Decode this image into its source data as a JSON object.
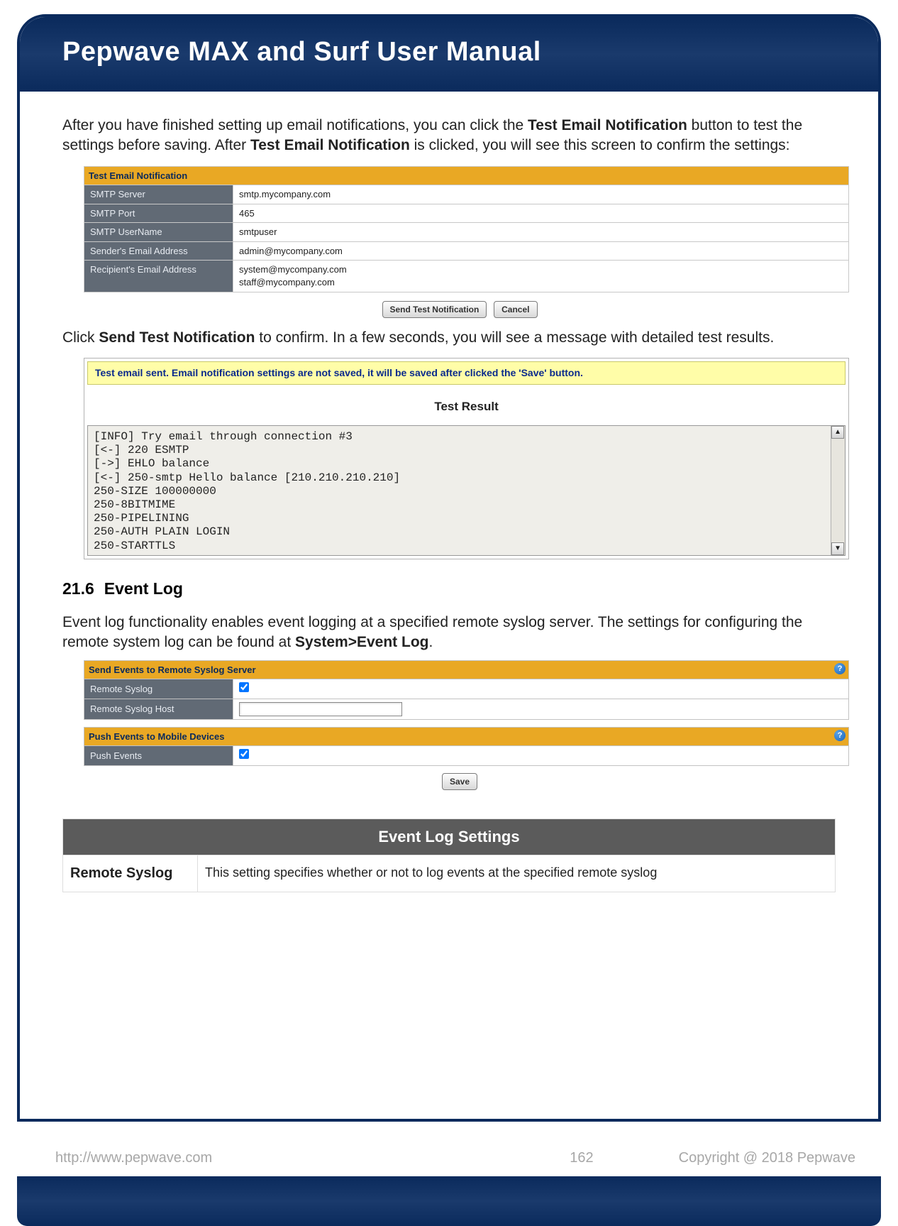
{
  "title": "Pepwave MAX and Surf User Manual",
  "intro": {
    "pre": "After you have finished setting up email notifications, you can click the ",
    "b1": "Test Email Notification",
    "mid1": " button to test the settings before saving. After ",
    "b2": "Test Email Notification",
    "post": " is clicked, you will see this screen to confirm the settings:"
  },
  "table1": {
    "header": "Test Email Notification",
    "rows": [
      {
        "k": "SMTP Server",
        "v": "smtp.mycompany.com"
      },
      {
        "k": "SMTP Port",
        "v": "465"
      },
      {
        "k": "SMTP UserName",
        "v": "smtpuser"
      },
      {
        "k": "Sender's Email Address",
        "v": "admin@mycompany.com"
      },
      {
        "k": "Recipient's Email Address",
        "v": "system@mycompany.com\nstaff@mycompany.com"
      }
    ],
    "btn_send": "Send Test Notification",
    "btn_cancel": "Cancel"
  },
  "para2": {
    "pre": "Click ",
    "b": "Send Test Notification",
    "post": " to confirm. In a few seconds, you will see a message with detailed test results."
  },
  "notice": "Test email sent. Email notification settings are not saved, it will be saved after clicked the 'Save' button.",
  "test_result_title": "Test Result",
  "log": "[INFO] Try email through connection #3\n[<-] 220 ESMTP\n[->] EHLO balance\n[<-] 250-smtp Hello balance [210.210.210.210]\n250-SIZE 100000000\n250-8BITMIME\n250-PIPELINING\n250-AUTH PLAIN LOGIN\n250-STARTTLS",
  "section": {
    "num": "21.6",
    "title": "Event Log"
  },
  "para3": {
    "pre": "Event log functionality enables event logging at a specified remote syslog server. The settings for configuring the remote system log can be found at ",
    "b": "System>Event Log",
    "post": "."
  },
  "cfg1": {
    "header": "Send Events to Remote Syslog Server",
    "r1": "Remote Syslog",
    "r2": "Remote Syslog Host"
  },
  "cfg2": {
    "header": "Push Events to Mobile Devices",
    "r1": "Push Events"
  },
  "btn_save": "Save",
  "settings": {
    "header": "Event Log Settings",
    "r1_label": "Remote Syslog",
    "r1_desc": "This setting specifies whether or not to log events at the specified remote syslog"
  },
  "footer": {
    "url": "http://www.pepwave.com",
    "page": "162",
    "copy": "Copyright @ 2018 Pepwave"
  }
}
